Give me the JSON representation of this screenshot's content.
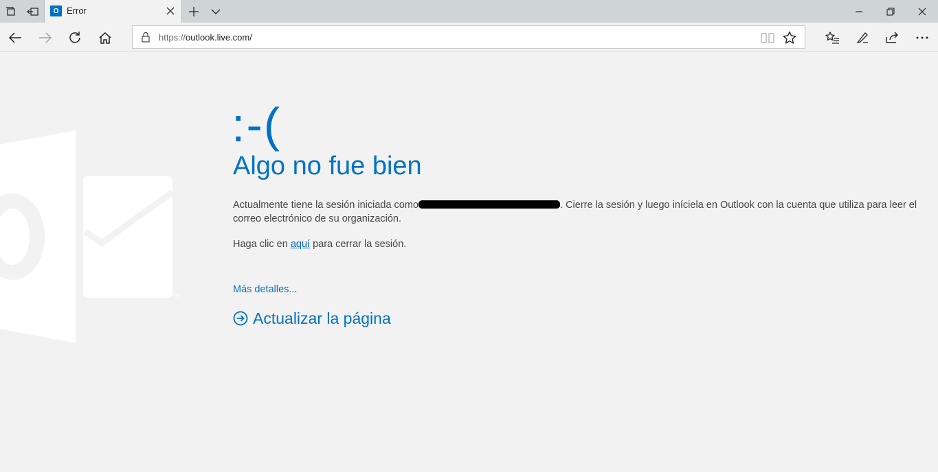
{
  "browser": {
    "tab": {
      "title": "Error",
      "favicon": "outlook-favicon-icon"
    },
    "address": {
      "scheme": "https://",
      "host": "outlook.live.com/"
    }
  },
  "error_page": {
    "emoticon": ":-(",
    "heading": "Algo no fue bien",
    "message_before": "Actualmente tiene la sesión iniciada como",
    "message_after": ". Cierre la sesión y luego iníciela en Outlook con la cuenta que utiliza para leer el correo electrónico de su organización.",
    "signout_prefix": "Haga clic en ",
    "signout_link": "aquí",
    "signout_suffix": " para cerrar la sesión.",
    "details_link": "Más detalles...",
    "refresh_label": "Actualizar la página"
  },
  "colors": {
    "accent": "#0072c6",
    "page_bg": "#f2f2f2",
    "tabbar_bg": "#cfd4d6"
  }
}
